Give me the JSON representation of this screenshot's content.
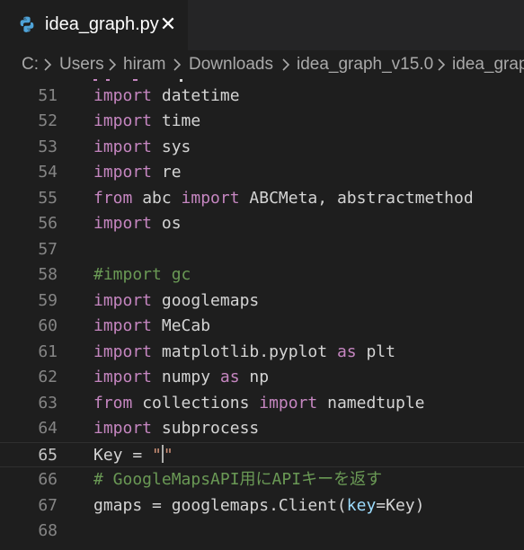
{
  "tab": {
    "title": "idea_graph.py",
    "close_glyph": "✕",
    "icon": "python-icon"
  },
  "breadcrumb": [
    "C:",
    "Users",
    "hiram",
    "Downloads",
    "idea_graph_v15.0",
    "idea_graph"
  ],
  "colors": {
    "keyword": "#c586c0",
    "comment": "#6a9955",
    "string": "#ce9178",
    "parameter": "#9cdcfe",
    "text": "#d4d4d4",
    "line_number": "#858585"
  },
  "editor": {
    "active_line": 65,
    "lines": [
      {
        "n": "51",
        "tokens": [
          {
            "t": "import",
            "c": "kw"
          },
          {
            "t": " datetime",
            "c": ""
          }
        ]
      },
      {
        "n": "52",
        "tokens": [
          {
            "t": "import",
            "c": "kw"
          },
          {
            "t": " time",
            "c": ""
          }
        ]
      },
      {
        "n": "53",
        "tokens": [
          {
            "t": "import",
            "c": "kw"
          },
          {
            "t": " sys",
            "c": ""
          }
        ]
      },
      {
        "n": "54",
        "tokens": [
          {
            "t": "import",
            "c": "kw"
          },
          {
            "t": " re",
            "c": ""
          }
        ]
      },
      {
        "n": "55",
        "tokens": [
          {
            "t": "from",
            "c": "kw"
          },
          {
            "t": " abc ",
            "c": ""
          },
          {
            "t": "import",
            "c": "kw"
          },
          {
            "t": " ABCMeta, abstractmethod",
            "c": ""
          }
        ]
      },
      {
        "n": "56",
        "tokens": [
          {
            "t": "import",
            "c": "kw"
          },
          {
            "t": " os",
            "c": ""
          }
        ]
      },
      {
        "n": "57",
        "tokens": []
      },
      {
        "n": "58",
        "tokens": [
          {
            "t": "#import gc",
            "c": "cm"
          }
        ]
      },
      {
        "n": "59",
        "tokens": [
          {
            "t": "import",
            "c": "kw"
          },
          {
            "t": " googlemaps",
            "c": ""
          }
        ]
      },
      {
        "n": "60",
        "tokens": [
          {
            "t": "import",
            "c": "kw"
          },
          {
            "t": " MeCab",
            "c": ""
          }
        ]
      },
      {
        "n": "61",
        "tokens": [
          {
            "t": "import",
            "c": "kw"
          },
          {
            "t": " matplotlib.pyplot ",
            "c": ""
          },
          {
            "t": "as",
            "c": "kw"
          },
          {
            "t": " plt",
            "c": ""
          }
        ]
      },
      {
        "n": "62",
        "tokens": [
          {
            "t": "import",
            "c": "kw"
          },
          {
            "t": " numpy ",
            "c": ""
          },
          {
            "t": "as",
            "c": "kw"
          },
          {
            "t": " np",
            "c": ""
          }
        ]
      },
      {
        "n": "63",
        "tokens": [
          {
            "t": "from",
            "c": "kw"
          },
          {
            "t": " collections ",
            "c": ""
          },
          {
            "t": "import",
            "c": "kw"
          },
          {
            "t": " namedtuple",
            "c": ""
          }
        ]
      },
      {
        "n": "64",
        "tokens": [
          {
            "t": "import",
            "c": "kw"
          },
          {
            "t": " subprocess",
            "c": ""
          }
        ]
      },
      {
        "n": "65",
        "tokens": [
          {
            "t": "Key = ",
            "c": ""
          },
          {
            "t": "\"",
            "c": "st"
          },
          {
            "t": "|",
            "c": "cursor"
          },
          {
            "t": "\"",
            "c": "st"
          }
        ]
      },
      {
        "n": "66",
        "tokens": [
          {
            "t": "# GoogleMapsAPI用にAPIキーを返す",
            "c": "cm"
          }
        ]
      },
      {
        "n": "67",
        "tokens": [
          {
            "t": "gmaps = googlemaps.Client(",
            "c": ""
          },
          {
            "t": "key",
            "c": "pa"
          },
          {
            "t": "=Key)",
            "c": ""
          }
        ]
      },
      {
        "n": "68",
        "tokens": []
      }
    ]
  }
}
